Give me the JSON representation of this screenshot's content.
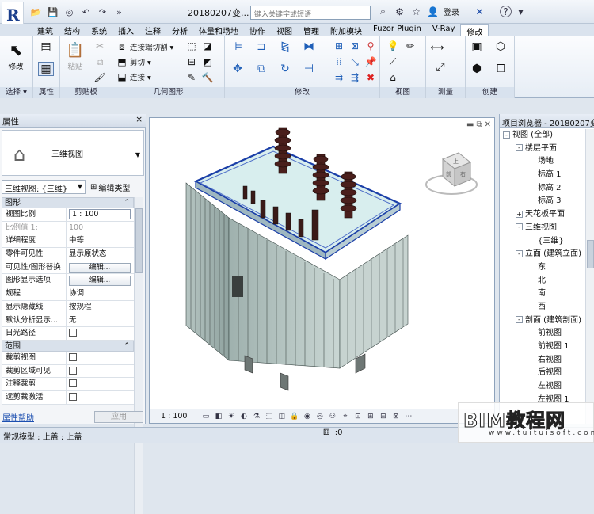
{
  "title_bar": {
    "app_logo": "R",
    "document_title": "20180207变...",
    "search_placeholder": "键入关键字或短语",
    "login_label": "登录",
    "help_label": "?"
  },
  "tabs": [
    "建筑",
    "结构",
    "系统",
    "插入",
    "注释",
    "分析",
    "体量和场地",
    "协作",
    "视图",
    "管理",
    "附加模块",
    "Fuzor Plugin",
    "V-Ray",
    "修改"
  ],
  "active_tab": "修改",
  "ribbon": {
    "select": {
      "button": "修改",
      "label": "选择 ▾"
    },
    "properties": {
      "label": "属性"
    },
    "clipboard": {
      "paste": "粘贴",
      "label": "剪贴板"
    },
    "geometry": {
      "cope": "连接端切割 ▾",
      "cut": "剪切 ▾",
      "join": "连接 ▾",
      "label": "几何图形"
    },
    "modify": {
      "label": "修改"
    },
    "view": {
      "label": "视图"
    },
    "measure": {
      "label": "测量"
    },
    "create": {
      "label": "创建"
    }
  },
  "properties_panel": {
    "header": "属性",
    "close": "×",
    "type_name": "三维视图",
    "instance_selector": "三维视图: {三维}",
    "edit_type": "编辑类型",
    "groups": [
      {
        "name": "图形",
        "rows": [
          {
            "key": "视图比例",
            "value": "1 : 100",
            "kind": "input"
          },
          {
            "key": "比例值 1:",
            "value": "100",
            "kind": "dim"
          },
          {
            "key": "详细程度",
            "value": "中等",
            "kind": "text"
          },
          {
            "key": "零件可见性",
            "value": "显示原状态",
            "kind": "text"
          },
          {
            "key": "可见性/图形替换",
            "value": "编辑...",
            "kind": "button"
          },
          {
            "key": "图形显示选项",
            "value": "编辑...",
            "kind": "button"
          },
          {
            "key": "规程",
            "value": "协调",
            "kind": "text"
          },
          {
            "key": "显示隐藏线",
            "value": "按规程",
            "kind": "text"
          },
          {
            "key": "默认分析显示...",
            "value": "无",
            "kind": "text"
          },
          {
            "key": "日光路径",
            "value": "",
            "kind": "check"
          }
        ]
      },
      {
        "name": "范围",
        "rows": [
          {
            "key": "裁剪视图",
            "value": "",
            "kind": "check"
          },
          {
            "key": "裁剪区域可见",
            "value": "",
            "kind": "check"
          },
          {
            "key": "注释裁剪",
            "value": "",
            "kind": "check"
          },
          {
            "key": "远剪裁激活",
            "value": "",
            "kind": "check"
          }
        ]
      }
    ],
    "help_link": "属性帮助",
    "apply": "应用"
  },
  "view": {
    "scale": "1 : 100",
    "cube": {
      "top": "上",
      "front": "前",
      "right": "右"
    }
  },
  "project_browser": {
    "header": "项目浏览器 - 20180207变...",
    "tree": [
      {
        "label": "视图 (全部)",
        "level": 0,
        "toggle": "-"
      },
      {
        "label": "楼层平面",
        "level": 1,
        "toggle": "-"
      },
      {
        "label": "场地",
        "level": 2,
        "toggle": ""
      },
      {
        "label": "标高 1",
        "level": 2,
        "toggle": ""
      },
      {
        "label": "标高 2",
        "level": 2,
        "toggle": ""
      },
      {
        "label": "标高 3",
        "level": 2,
        "toggle": ""
      },
      {
        "label": "天花板平面",
        "level": 1,
        "toggle": "+"
      },
      {
        "label": "三维视图",
        "level": 1,
        "toggle": "-"
      },
      {
        "label": "{三维}",
        "level": 2,
        "toggle": ""
      },
      {
        "label": "立面 (建筑立面)",
        "level": 1,
        "toggle": "-"
      },
      {
        "label": "东",
        "level": 2,
        "toggle": ""
      },
      {
        "label": "北",
        "level": 2,
        "toggle": ""
      },
      {
        "label": "南",
        "level": 2,
        "toggle": ""
      },
      {
        "label": "西",
        "level": 2,
        "toggle": ""
      },
      {
        "label": "剖面 (建筑剖面)",
        "level": 1,
        "toggle": "-"
      },
      {
        "label": "前视图",
        "level": 2,
        "toggle": ""
      },
      {
        "label": "前视图 1",
        "level": 2,
        "toggle": ""
      },
      {
        "label": "右视图",
        "level": 2,
        "toggle": ""
      },
      {
        "label": "后视图",
        "level": 2,
        "toggle": ""
      },
      {
        "label": "左视图",
        "level": 2,
        "toggle": ""
      },
      {
        "label": "左视图 1",
        "level": 2,
        "toggle": ""
      }
    ]
  },
  "status_bar": {
    "text": "常规模型 : 上盖 : 上盖",
    "zero": ":0"
  },
  "watermark": {
    "main": "BIM教程网",
    "sub": "www.tuituisoft.com"
  }
}
